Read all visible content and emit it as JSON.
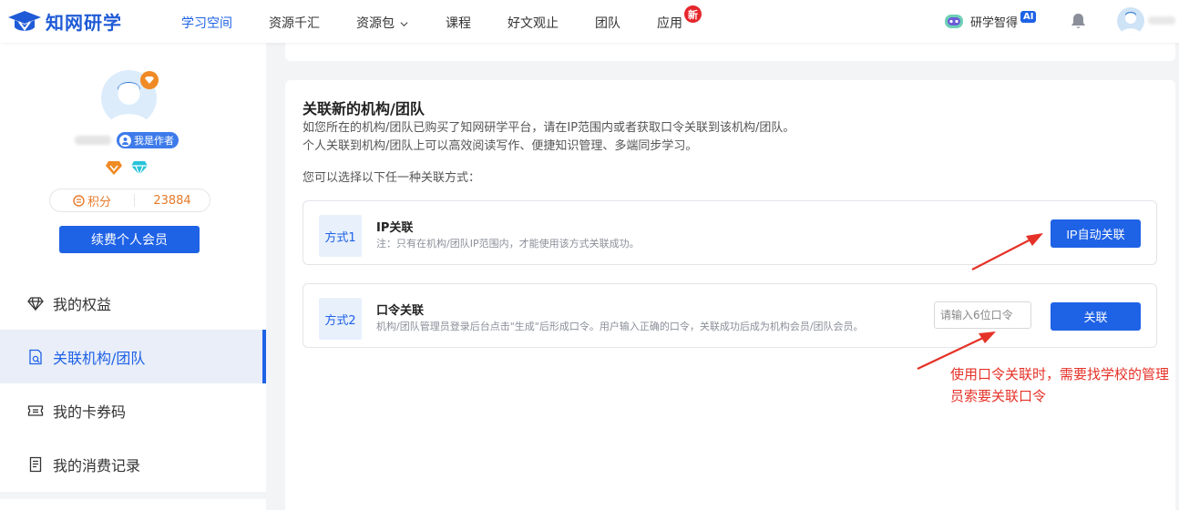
{
  "header": {
    "logo_text": "知网研学",
    "nav": [
      {
        "label": "学习空间",
        "active": true
      },
      {
        "label": "资源千汇"
      },
      {
        "label": "资源包",
        "dropdown": true
      },
      {
        "label": "课程"
      },
      {
        "label": "好文观止"
      },
      {
        "label": "团队"
      },
      {
        "label": "应用",
        "badge": "新"
      }
    ],
    "ai_label": "研学智得",
    "ai_badge": "AI"
  },
  "sidebar": {
    "author_tag": "我是作者",
    "points_label": "积分",
    "points_value": "23884",
    "renew_button": "续费个人会员",
    "menu": [
      {
        "label": "我的权益",
        "icon": "diamond-icon"
      },
      {
        "label": "关联机构/团队",
        "icon": "link-org-icon",
        "active": true
      },
      {
        "label": "我的卡券码",
        "icon": "ticket-icon"
      },
      {
        "label": "我的消费记录",
        "icon": "receipt-icon"
      }
    ]
  },
  "main": {
    "title": "关联新的机构/团队",
    "desc": [
      "如您所在的机构/团队已购买了知网研学平台，请在IP范围内或者获取口令关联到该机构/团队。",
      "个人关联到机构/团队上可以高效阅读写作、便捷知识管理、多端同步学习。"
    ],
    "choose_text": "您可以选择以下任一种关联方式：",
    "method1": {
      "tag": "方式1",
      "name": "IP关联",
      "note": "注：只有在机构/团队IP范围内，才能使用该方式关联成功。",
      "button": "IP自动关联"
    },
    "method2": {
      "tag": "方式2",
      "name": "口令关联",
      "note": "机构/团队管理员登录后台点击\"生成\"后形成口令。用户输入正确的口令，关联成功后成为机构会员/团队会员。",
      "input_placeholder": "请输入6位口令",
      "button": "关联"
    }
  },
  "annotation": {
    "text": "使用口令关联时，需要找学校的管理员索要关联口令",
    "color": "#e53228"
  },
  "colors": {
    "primary": "#1e62e6",
    "orange": "#e77a2a"
  }
}
